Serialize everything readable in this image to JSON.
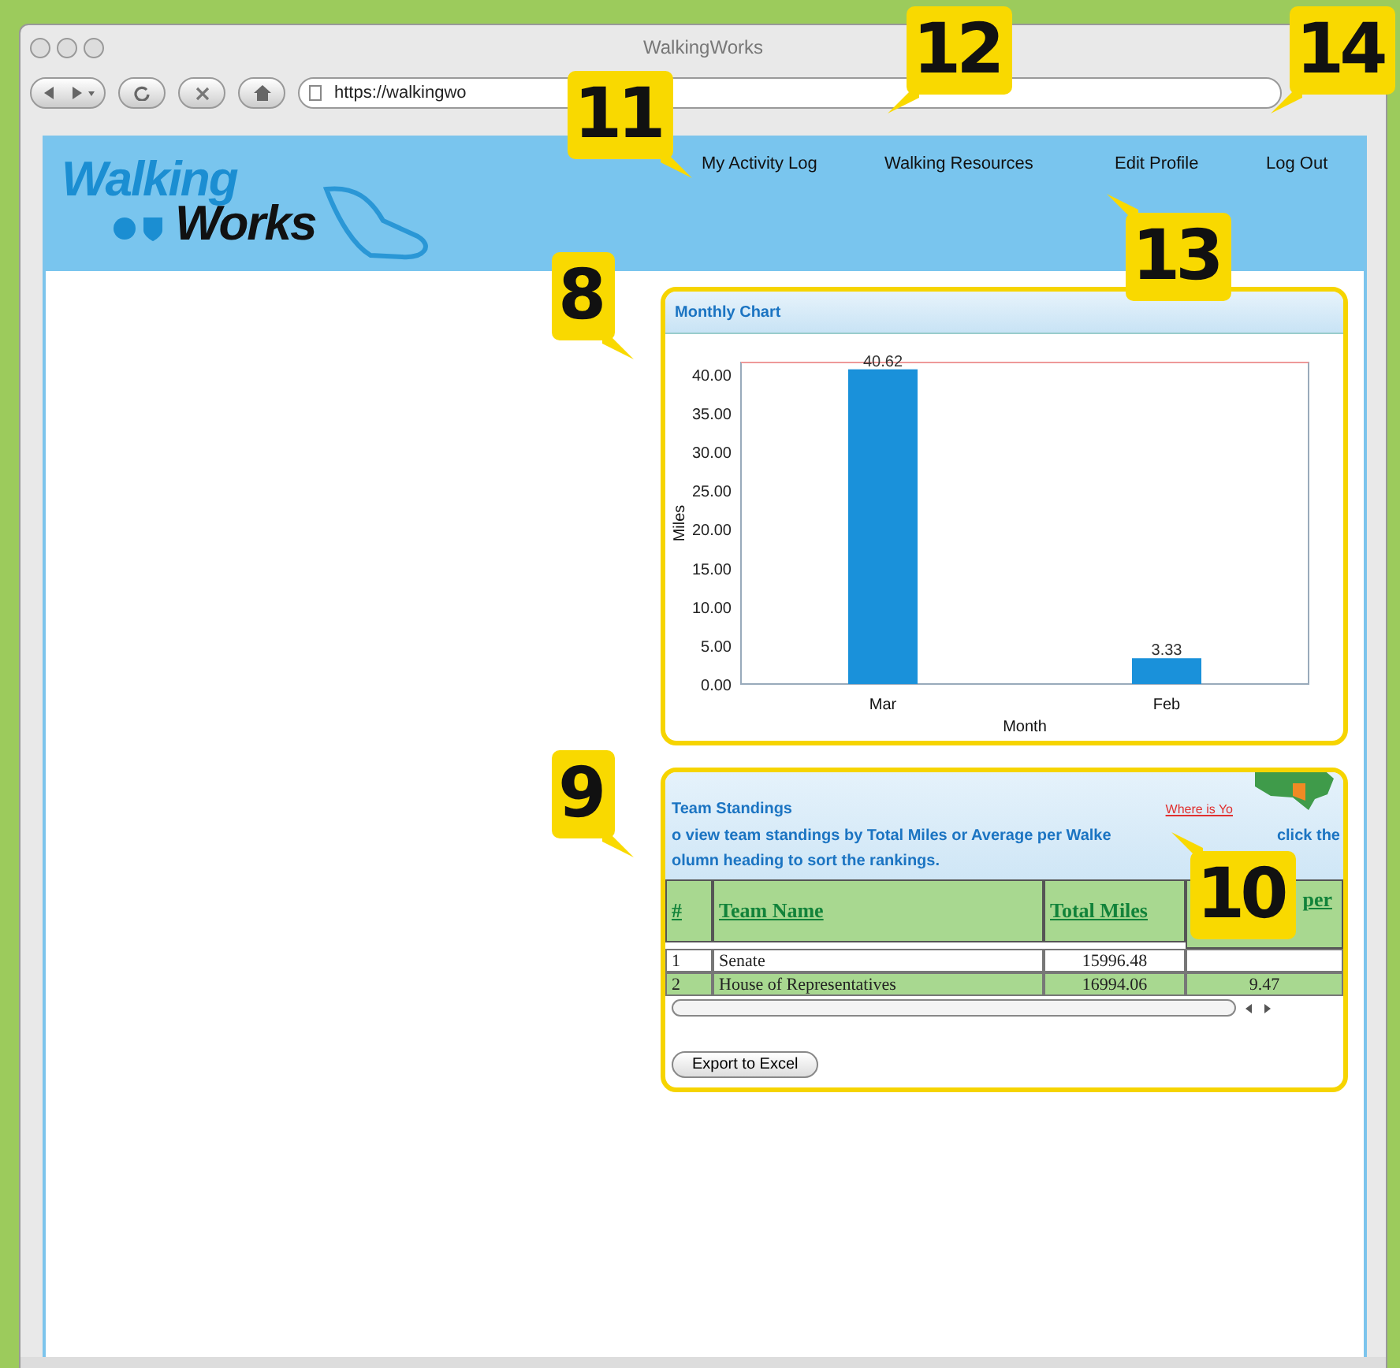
{
  "window": {
    "title": "WalkingWorks"
  },
  "toolbar": {
    "address": "https://walkingwo"
  },
  "header": {
    "logo_top": "Walking",
    "logo_bottom": "Works",
    "nav": [
      {
        "label": "My Activity Log"
      },
      {
        "label": "Walking Resources"
      },
      {
        "label": "Edit Profile"
      },
      {
        "label": "Log Out"
      }
    ]
  },
  "monthly_chart": {
    "title": "Monthly Chart",
    "chart_data": {
      "type": "bar",
      "xlabel": "Month",
      "ylabel": "Miles",
      "categories": [
        "Mar",
        "Feb"
      ],
      "values": [
        40.62,
        3.33
      ],
      "ylim": [
        0,
        41.5
      ],
      "yticks": [
        {
          "value": 0,
          "label": "0.00"
        },
        {
          "value": 5,
          "label": "5.00"
        },
        {
          "value": 10,
          "label": "10.00"
        },
        {
          "value": 15,
          "label": "15.00"
        },
        {
          "value": 20,
          "label": "20.00"
        },
        {
          "value": 25,
          "label": "25.00"
        },
        {
          "value": 30,
          "label": "30.00"
        },
        {
          "value": 35,
          "label": "35.00"
        },
        {
          "value": 40,
          "label": "40.00"
        }
      ],
      "data_labels": true
    }
  },
  "team_standings": {
    "title": "Team Standings",
    "link": "Where is Yo",
    "instructions": [
      "o view team standings by Total Miles or Average per Walke",
      "click the",
      "olumn heading to sort the rankings."
    ],
    "columns": [
      "#",
      "Team Name",
      "Total Miles",
      "per"
    ],
    "rows": [
      {
        "cells": [
          "1",
          "Senate",
          "15996.48"
        ]
      },
      {
        "cells": [
          "2",
          "House of Representatives",
          "16994.06",
          "9.47"
        ]
      }
    ],
    "export_button": "Export to Excel"
  },
  "callouts": [
    {
      "label": "11"
    },
    {
      "label": "12"
    },
    {
      "label": "14"
    },
    {
      "label": "13"
    },
    {
      "label": "8"
    },
    {
      "label": "9"
    },
    {
      "label": "10"
    }
  ]
}
